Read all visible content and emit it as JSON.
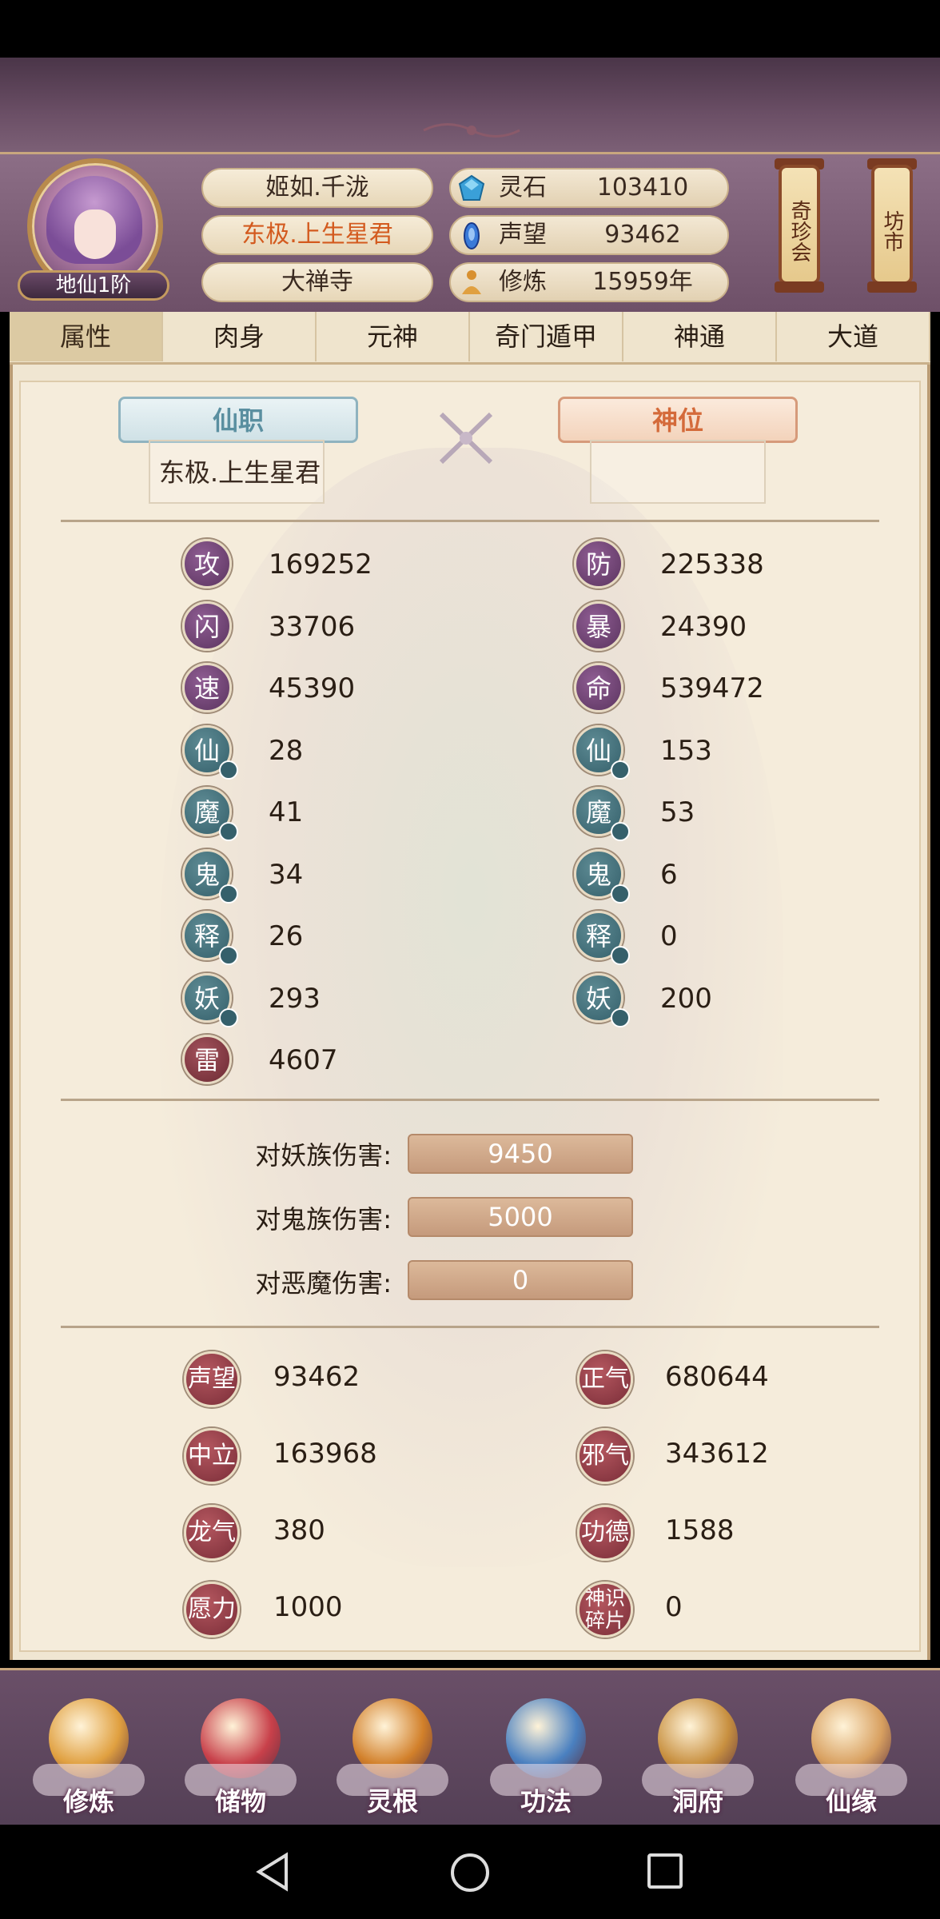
{
  "header": {
    "realm": "地仙1阶",
    "player_name": "姬如.千泷",
    "title": "东极.上生星君",
    "sect": "大禅寺",
    "resources": [
      {
        "icon": "spirit-stone-icon",
        "label": "灵石",
        "value": "103410"
      },
      {
        "icon": "reputation-icon",
        "label": "声望",
        "value": "93462"
      },
      {
        "icon": "cultivation-icon",
        "label": "修炼",
        "value": "15959年"
      }
    ],
    "lanterns": [
      {
        "label": "奇珍会"
      },
      {
        "label": "坊市"
      }
    ]
  },
  "tabs": [
    "属性",
    "肉身",
    "元神",
    "奇门遁甲",
    "神通",
    "大道"
  ],
  "active_tab": "属性",
  "posts": {
    "xianzhi_label": "仙职",
    "xianzhi_value": "东极.上生星君",
    "shenwei_label": "神位"
  },
  "stats_left": [
    {
      "glyph": "攻",
      "value": "169252",
      "style": "purple",
      "mark": false
    },
    {
      "glyph": "闪",
      "value": "33706",
      "style": "purple",
      "mark": false
    },
    {
      "glyph": "速",
      "value": "45390",
      "style": "purple",
      "mark": false
    },
    {
      "glyph": "仙",
      "value": "28",
      "style": "teal",
      "mark": true
    },
    {
      "glyph": "魔",
      "value": "41",
      "style": "teal",
      "mark": true
    },
    {
      "glyph": "鬼",
      "value": "34",
      "style": "teal",
      "mark": true
    },
    {
      "glyph": "释",
      "value": "26",
      "style": "teal",
      "mark": true
    },
    {
      "glyph": "妖",
      "value": "293",
      "style": "teal",
      "mark": true
    },
    {
      "glyph": "雷",
      "value": "4607",
      "style": "red",
      "mark": false
    }
  ],
  "stats_right": [
    {
      "glyph": "防",
      "value": "225338",
      "style": "purple",
      "mark": false
    },
    {
      "glyph": "暴",
      "value": "24390",
      "style": "purple",
      "mark": false
    },
    {
      "glyph": "命",
      "value": "539472",
      "style": "purple",
      "mark": false
    },
    {
      "glyph": "仙",
      "value": "153",
      "style": "teal",
      "mark": true
    },
    {
      "glyph": "魔",
      "value": "53",
      "style": "teal",
      "mark": true
    },
    {
      "glyph": "鬼",
      "value": "6",
      "style": "teal",
      "mark": true
    },
    {
      "glyph": "释",
      "value": "0",
      "style": "teal",
      "mark": true
    },
    {
      "glyph": "妖",
      "value": "200",
      "style": "teal",
      "mark": true
    }
  ],
  "damage": [
    {
      "label": "对妖族伤害:",
      "value": "9450"
    },
    {
      "label": "对鬼族伤害:",
      "value": "5000"
    },
    {
      "label": "对恶魔伤害:",
      "value": "0"
    }
  ],
  "attributes_left": [
    {
      "label": "声望",
      "value": "93462"
    },
    {
      "label": "中立",
      "value": "163968"
    },
    {
      "label": "龙气",
      "value": "380"
    },
    {
      "label": "愿力",
      "value": "1000"
    }
  ],
  "attributes_right": [
    {
      "label": "正气",
      "value": "680644"
    },
    {
      "label": "邪气",
      "value": "343612"
    },
    {
      "label": "功德",
      "value": "1588"
    },
    {
      "label": "神识碎片",
      "value": "0"
    }
  ],
  "bottom_nav": [
    {
      "label": "修炼",
      "icon": "meditating-monk-icon",
      "color": "#e0a040"
    },
    {
      "label": "储物",
      "icon": "storage-bag-icon",
      "color": "#c8404a"
    },
    {
      "label": "灵根",
      "icon": "spirit-root-icon",
      "color": "#d2802a"
    },
    {
      "label": "功法",
      "icon": "skill-book-icon",
      "color": "#4a80c0"
    },
    {
      "label": "洞府",
      "icon": "cave-house-icon",
      "color": "#c89040"
    },
    {
      "label": "仙缘",
      "icon": "gourd-icon",
      "color": "#d8a060"
    }
  ]
}
